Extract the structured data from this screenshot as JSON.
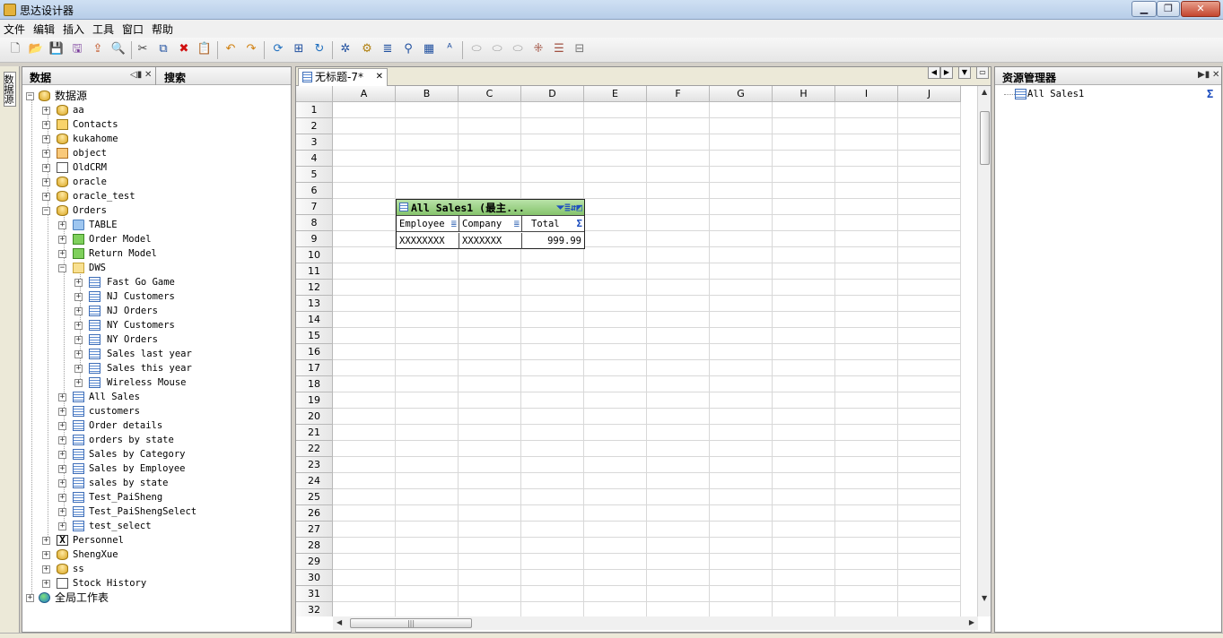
{
  "window": {
    "title": "思达设计器"
  },
  "menu": [
    "文件",
    "编辑",
    "插入",
    "工具",
    "窗口",
    "帮助"
  ],
  "toolbar_icons": [
    "new-file",
    "open-folder",
    "save",
    "save-all",
    "export",
    "print-preview",
    "cut",
    "copy",
    "delete",
    "paste",
    "undo",
    "redo",
    "refresh-layout",
    "tree-view",
    "reload",
    "wand",
    "gear-add",
    "align",
    "filter",
    "table-edit",
    "text-style",
    "merge",
    "merge-alt",
    "merge-more",
    "split",
    "grid-layout",
    "dashboard"
  ],
  "side_tab": "数据源",
  "left_panel": {
    "tab_data": "数据",
    "tab_search": "搜索",
    "tree": {
      "root": "数据源",
      "items": [
        "aa",
        "Contacts",
        "kukahome",
        "object",
        "OldCRM",
        "oracle",
        "oracle_test",
        "Orders"
      ],
      "orders_children": [
        "TABLE",
        "Order Model",
        "Return Model",
        "DWS"
      ],
      "dws_children": [
        "Fast Go Game",
        "NJ Customers",
        "NJ Orders",
        "NY Customers",
        "NY Orders",
        "Sales last year",
        "Sales this year",
        "Wireless Mouse"
      ],
      "orders_tables": [
        "All Sales",
        "customers",
        "Order details",
        "orders by state",
        "Sales by Category",
        "Sales by Employee",
        "sales by state",
        "Test_PaiSheng",
        "Test_PaiShengSelect",
        "test_select"
      ],
      "after": [
        "Personnel",
        "ShengXue",
        "ss",
        "Stock History"
      ],
      "global": "全局工作表"
    }
  },
  "editor": {
    "tab_title": "无标题-7*",
    "columns": [
      "A",
      "B",
      "C",
      "D",
      "E",
      "F",
      "G",
      "H",
      "I",
      "J"
    ],
    "rows": [
      "1",
      "2",
      "3",
      "4",
      "5",
      "6",
      "7",
      "8",
      "9",
      "10",
      "11",
      "12",
      "13",
      "14",
      "15",
      "16",
      "17",
      "18",
      "19",
      "20",
      "21",
      "22",
      "23",
      "24",
      "25",
      "26",
      "27",
      "28",
      "29",
      "30",
      "31",
      "32"
    ],
    "widget": {
      "title": "All Sales1 (最主...",
      "headers": [
        "Employee",
        "Company",
        "Total"
      ],
      "values": [
        "XXXXXXXX",
        "XXXXXXX",
        "999.99"
      ]
    }
  },
  "right_panel": {
    "title": "资源管理器",
    "item": "All Sales1",
    "sigma": "Σ"
  }
}
